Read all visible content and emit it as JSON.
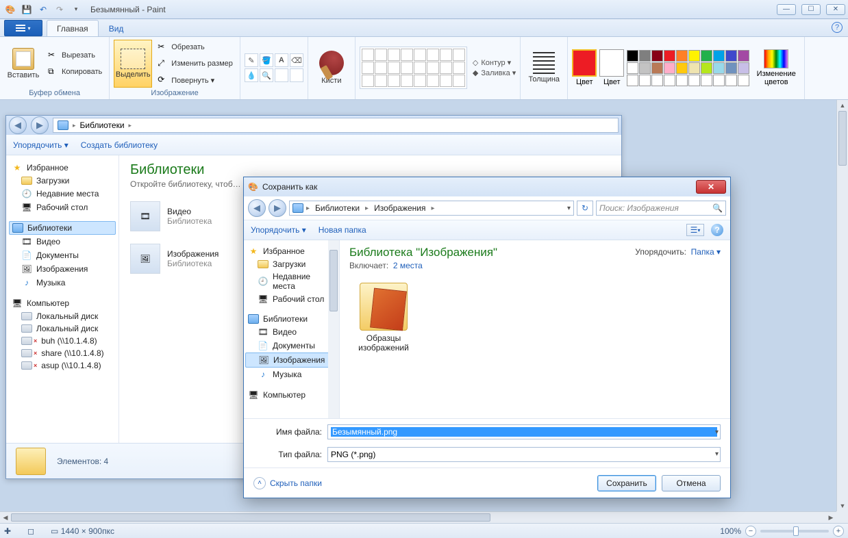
{
  "title": "Безымянный - Paint",
  "ribbon": {
    "tabs": {
      "home": "Главная",
      "view": "Вид"
    },
    "clipboard": {
      "paste": "Вставить",
      "cut": "Вырезать",
      "copy": "Копировать",
      "label": "Буфер обмена"
    },
    "image": {
      "select": "Выделить",
      "crop": "Обрезать",
      "resize": "Изменить размер",
      "rotate": "Повернуть ▾",
      "label": "Изображение"
    },
    "tools": {
      "label": ""
    },
    "brushes": {
      "label": "Кисти"
    },
    "shapes": {
      "outline": "Контур ▾",
      "fill": "Заливка ▾",
      "label": ""
    },
    "thickness": {
      "label": "Толщина"
    },
    "color": {
      "c1": "Цвет",
      "c2": "Цвет",
      "edit": "Изменение цветов"
    }
  },
  "palette": [
    "#000000",
    "#7f7f7f",
    "#880015",
    "#ed1c24",
    "#ff7f27",
    "#fff200",
    "#22b14c",
    "#00a2e8",
    "#3f48cc",
    "#a349a4",
    "#ffffff",
    "#c3c3c3",
    "#b97a57",
    "#ffaec9",
    "#ffc90e",
    "#efe4b0",
    "#b5e61d",
    "#99d9ea",
    "#7092be",
    "#c8bfe7",
    "#ffffff",
    "#ffffff",
    "#ffffff",
    "#ffffff",
    "#ffffff",
    "#ffffff",
    "#ffffff",
    "#ffffff",
    "#ffffff",
    "#ffffff"
  ],
  "bgExplorer": {
    "breadcrumb": "Библиотеки",
    "organize": "Упорядочить ▾",
    "newLib": "Создать библиотеку",
    "libTitle": "Библиотеки",
    "libSub": "Откройте библиотеку, чтоб…",
    "items": {
      "video": "Видео",
      "videoSub": "Библиотека",
      "images": "Изображения",
      "imagesSub": "Библиотека"
    },
    "status": "Элементов: 4",
    "tree": {
      "fav": "Избранное",
      "downloads": "Загрузки",
      "recent": "Недавние места",
      "desktop": "Рабочий стол",
      "libraries": "Библиотеки",
      "video": "Видео",
      "docs": "Документы",
      "images": "Изображения",
      "music": "Музыка",
      "computer": "Компьютер",
      "localDisk": "Локальный диск",
      "buh": "buh (\\\\10.1.4.8)",
      "share": "share (\\\\10.1.4.8)",
      "asup": "asup (\\\\10.1.4.8)"
    }
  },
  "dialog": {
    "title": "Сохранить как",
    "addr": {
      "seg1": "Библиотеки",
      "seg2": "Изображения"
    },
    "searchPlaceholder": "Поиск: Изображения",
    "organize": "Упорядочить ▾",
    "newFolder": "Новая папка",
    "sortLabel": "Упорядочить:",
    "sortValue": "Папка ▾",
    "libTitle": "Библиотека \"Изображения\"",
    "includesLabel": "Включает:",
    "includesLink": "2 места",
    "sampleFolder": "Образцы изображений",
    "filenameLabel": "Имя файла:",
    "filenameValue": "Безымянный.png",
    "filetypeLabel": "Тип файла:",
    "filetypeValue": "PNG (*.png)",
    "hideFolders": "Скрыть папки",
    "save": "Сохранить",
    "cancel": "Отмена",
    "tree": {
      "fav": "Избранное",
      "downloads": "Загрузки",
      "recent": "Недавние места",
      "desktop": "Рабочий стол",
      "libraries": "Библиотеки",
      "video": "Видео",
      "docs": "Документы",
      "images": "Изображения",
      "music": "Музыка",
      "computer": "Компьютер"
    }
  },
  "statusbar": {
    "dimensions": "1440 × 900пкс",
    "zoom": "100%"
  }
}
